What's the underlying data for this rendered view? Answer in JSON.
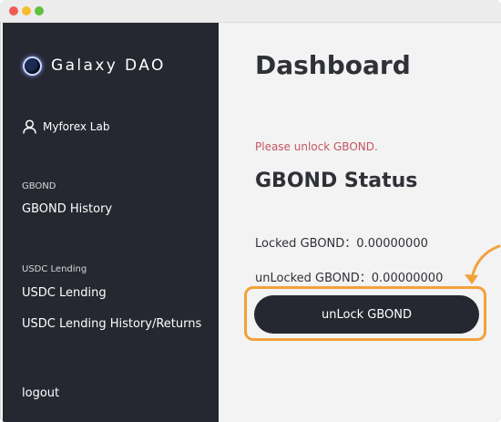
{
  "sidebar": {
    "brand": "Galaxy DAO",
    "user_name": "Myforex Lab",
    "sections": [
      {
        "label": "GBOND",
        "items": [
          "GBOND History"
        ]
      },
      {
        "label": "USDC Lending",
        "items": [
          "USDC Lending",
          "USDC Lending History/Returns"
        ]
      }
    ],
    "logout": "logout"
  },
  "main": {
    "title": "Dashboard",
    "warning": "Please unlock GBOND.",
    "status_title": "GBOND Status",
    "locked_label": "Locked GBOND：0.00000000",
    "unlocked_label": "unLocked GBOND：0.00000000",
    "unlock_button": "unLock GBOND"
  },
  "colors": {
    "sidebar_bg": "#262831",
    "highlight": "#f2a13a",
    "warning_text": "#c45563"
  },
  "icons": {
    "brand": "galaxy-orb-icon",
    "user": "user-icon",
    "callout": "curved-arrow-icon"
  }
}
